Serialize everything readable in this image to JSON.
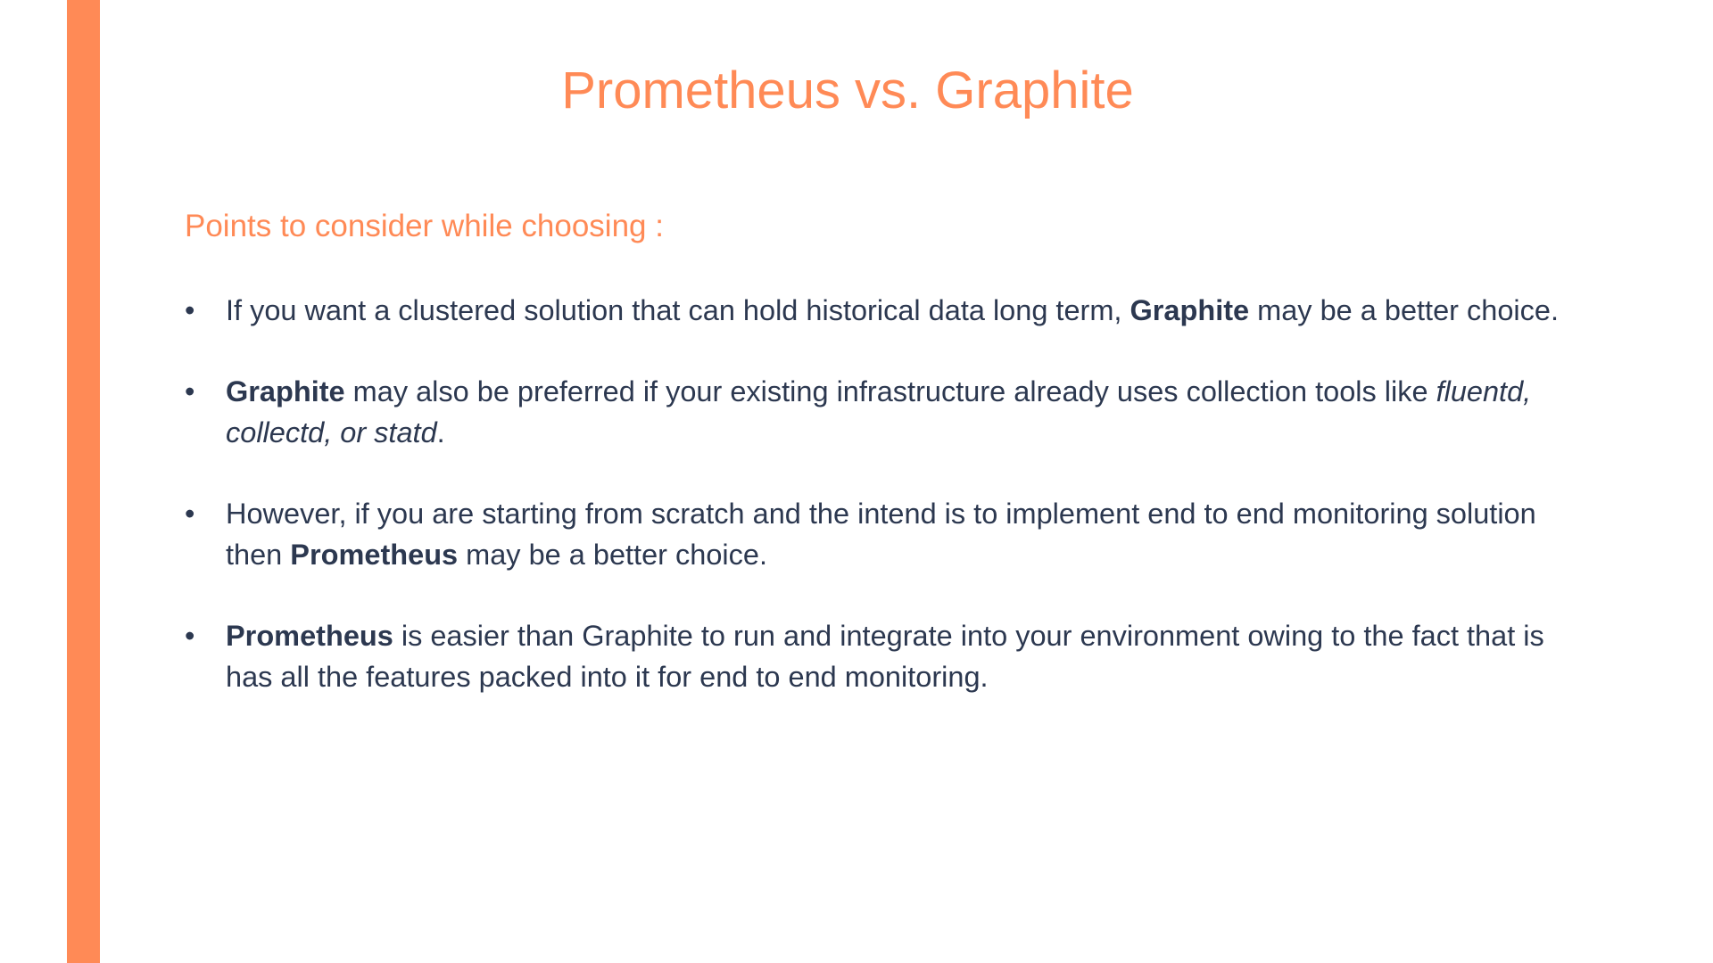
{
  "slide": {
    "title": "Prometheus vs. Graphite",
    "subtitle": "Points to consider while choosing :",
    "colors": {
      "accent": "#ff8a56",
      "text": "#2c3850",
      "background": "#ffffff"
    },
    "bullet_symbol": "•",
    "bullets": [
      {
        "t1": "If you want a clustered solution that can hold historical data long term, ",
        "b1": "Graphite",
        "t2": " may be a better choice."
      },
      {
        "b1": "Graphite",
        "t1": " may also be preferred if your existing infrastructure already uses collection tools like ",
        "i1": "fluentd, collectd, or statd",
        "t2": "."
      },
      {
        "t1": "However, if you are starting from scratch and the intend is to implement end to end monitoring solution then ",
        "b1": "Prometheus",
        "t2": " may be a better choice."
      },
      {
        "b1": "Prometheus",
        "t1": " is easier than Graphite to run and integrate into your environment owing to the fact that is has all the features packed into it for end to end monitoring."
      }
    ]
  }
}
